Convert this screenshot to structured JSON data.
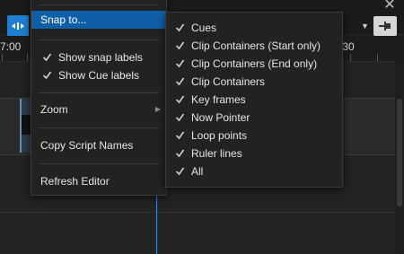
{
  "ruler": {
    "left_time": "7:00",
    "right_time": ":30"
  },
  "window": {
    "close_glyph": "✕"
  },
  "menu": {
    "snap_to": "Snap to...",
    "show_snap_labels": "Show snap labels",
    "show_cue_labels": "Show Cue labels",
    "zoom": "Zoom",
    "copy_script_names": "Copy Script Names",
    "refresh_editor": "Refresh Editor"
  },
  "snap_submenu": {
    "items": [
      {
        "label": "Cues",
        "checked": true
      },
      {
        "label": "Clip Containers (Start only)",
        "checked": true
      },
      {
        "label": "Clip Containers (End only)",
        "checked": true
      },
      {
        "label": "Clip Containers",
        "checked": true
      },
      {
        "label": "Key frames",
        "checked": true
      },
      {
        "label": "Now Pointer",
        "checked": true
      },
      {
        "label": "Loop points",
        "checked": true
      },
      {
        "label": "Ruler lines",
        "checked": true
      },
      {
        "label": "All",
        "checked": true
      }
    ]
  },
  "icons": {
    "snap_toggle": "snap-magnet-icon",
    "pin": "pin-icon",
    "check": "checkmark-icon",
    "submenu": "chevron-right-icon",
    "dropdown": "caret-down-icon"
  },
  "colors": {
    "accent": "#1e7fd0",
    "highlight": "#0f5fa8",
    "now_pointer": "#3d8be0"
  }
}
